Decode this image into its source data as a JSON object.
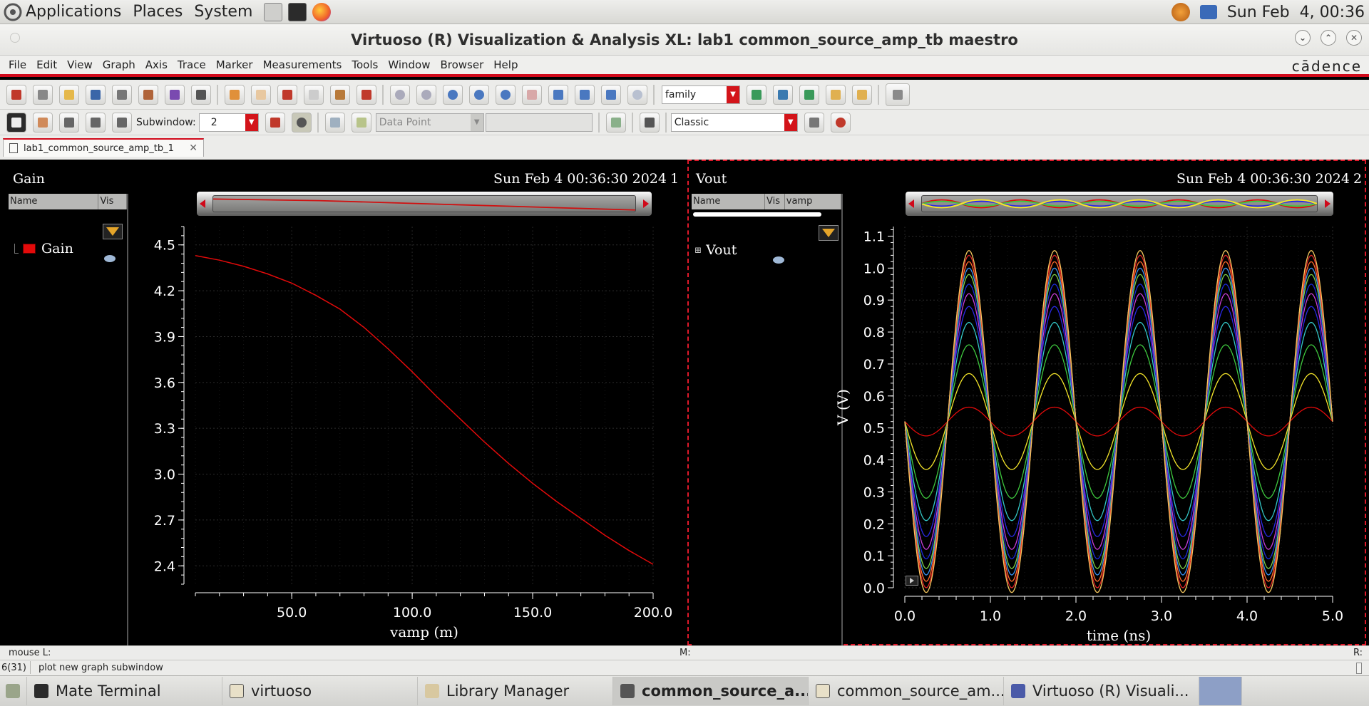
{
  "topbar": {
    "menus": [
      "Applications",
      "Places",
      "System"
    ],
    "clock": "Sun Feb  4, 00:36"
  },
  "window": {
    "title": "Virtuoso (R) Visualization & Analysis XL: lab1 common_source_amp_tb maestro"
  },
  "menubar": {
    "items": [
      "File",
      "Edit",
      "View",
      "Graph",
      "Axis",
      "Trace",
      "Marker",
      "Measurements",
      "Tools",
      "Window",
      "Browser",
      "Help"
    ],
    "brand": "cādence"
  },
  "toolbar": {
    "family_value": "family",
    "subwindow_label": "Subwindow:",
    "subwindow_value": "2",
    "datapoint_value": "Data Point",
    "style_value": "Classic"
  },
  "tab": {
    "label": "lab1_common_source_amp_tb_1"
  },
  "pane1": {
    "title": "Gain",
    "timestamp": "Sun Feb 4 00:36:30 2024",
    "index": "1",
    "legend_headers": [
      "Name",
      "Vis"
    ],
    "legend_item": "Gain"
  },
  "pane2": {
    "title": "Vout",
    "timestamp": "Sun Feb 4 00:36:30 2024",
    "index": "2",
    "legend_headers": [
      "Name",
      "Vis",
      "vamp"
    ],
    "legend_item": "Vout"
  },
  "chart_data": [
    {
      "type": "line",
      "title": "Gain",
      "xlabel": "vamp (m)",
      "ylabel": "",
      "xlim": [
        10,
        200
      ],
      "ylim": [
        2.28,
        4.62
      ],
      "xticks": [
        50.0,
        100.0,
        150.0,
        200.0
      ],
      "xtick_labels": [
        "50.0",
        "100.0",
        "150.0",
        "200.0"
      ],
      "yticks": [
        2.4,
        2.7,
        3.0,
        3.3,
        3.6,
        3.9,
        4.2,
        4.5
      ],
      "ytick_labels": [
        "2.4",
        "2.7",
        "3.0",
        "3.3",
        "3.6",
        "3.9",
        "4.2",
        "4.5"
      ],
      "grid": true,
      "series": [
        {
          "name": "Gain",
          "color": "#e30a0a",
          "x": [
            10,
            20,
            30,
            40,
            50,
            60,
            70,
            80,
            90,
            100,
            110,
            120,
            130,
            140,
            150,
            160,
            170,
            180,
            190,
            200
          ],
          "y": [
            4.43,
            4.4,
            4.36,
            4.31,
            4.25,
            4.17,
            4.08,
            3.96,
            3.82,
            3.67,
            3.51,
            3.36,
            3.21,
            3.07,
            2.94,
            2.82,
            2.71,
            2.6,
            2.5,
            2.41
          ]
        }
      ]
    },
    {
      "type": "line",
      "title": "Vout",
      "xlabel": "time (ns)",
      "ylabel": "V (V)",
      "xlim": [
        0.0,
        5.0
      ],
      "ylim": [
        0.0,
        1.13
      ],
      "xticks": [
        0.0,
        1.0,
        2.0,
        3.0,
        4.0,
        5.0
      ],
      "xtick_labels": [
        "0.0",
        "1.0",
        "2.0",
        "3.0",
        "4.0",
        "5.0"
      ],
      "yticks": [
        0.0,
        0.1,
        0.2,
        0.3,
        0.4,
        0.5,
        0.6,
        0.7,
        0.8,
        0.9,
        1.0,
        1.1
      ],
      "ytick_labels": [
        "0.0",
        "0.1",
        "0.2",
        "0.3",
        "0.4",
        "0.5",
        "0.6",
        "0.7",
        "0.8",
        "0.9",
        "1.0",
        "1.1"
      ],
      "grid": true,
      "signal": {
        "offset": 0.52,
        "period_ns": 1.0,
        "peak_at_ns": 0.75
      },
      "series": [
        {
          "color": "#e30a0a",
          "amplitude": 0.045
        },
        {
          "color": "#f5e62a",
          "amplitude": 0.15
        },
        {
          "color": "#3ec83e",
          "amplitude": 0.24
        },
        {
          "color": "#34c7c7",
          "amplitude": 0.31
        },
        {
          "color": "#2929e6",
          "amplitude": 0.36
        },
        {
          "color": "#c63fd6",
          "amplitude": 0.4
        },
        {
          "color": "#1a2bd9",
          "amplitude": 0.43
        },
        {
          "color": "#7cd046",
          "amplitude": 0.46
        },
        {
          "color": "#3a8ff0",
          "amplitude": 0.48
        },
        {
          "color": "#ff6a2a",
          "amplitude": 0.5
        },
        {
          "color": "#e12525",
          "amplitude": 0.52
        },
        {
          "color": "#f7c85e",
          "amplitude": 0.535
        }
      ]
    }
  ],
  "status": {
    "mouse_l": "mouse L:",
    "mouse_m": "M:",
    "mouse_r": "R:",
    "count": "6(31)",
    "message": "plot new graph subwindow"
  },
  "taskbar": {
    "items": [
      "Mate Terminal",
      "virtuoso",
      "Library Manager",
      "common_source_a...",
      "common_source_am...",
      "Virtuoso (R) Visuali..."
    ]
  }
}
